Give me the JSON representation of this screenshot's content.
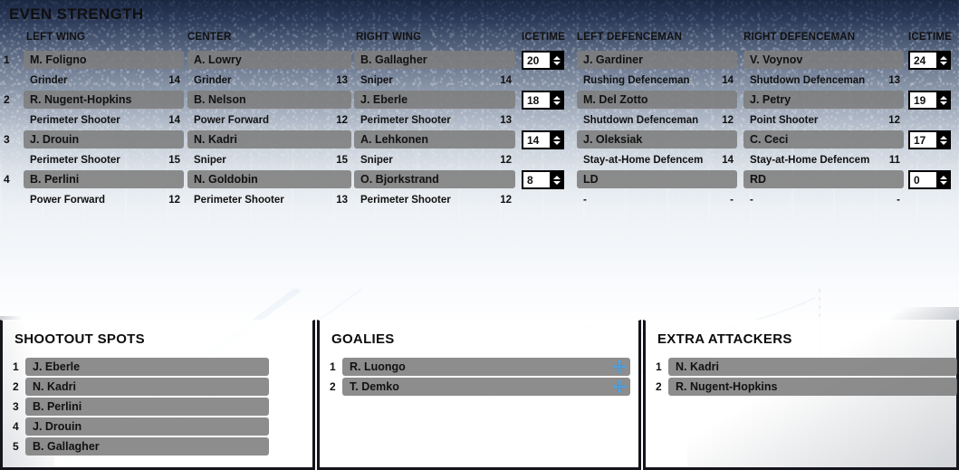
{
  "background": {
    "scene": "hockey-arena-ice-faded",
    "top_color": "#1b2740",
    "bottom_color": "#ffffff"
  },
  "even_strength": {
    "title": "EVEN STRENGTH",
    "headers": {
      "left_wing": "LEFT WING",
      "center": "CENTER",
      "right_wing": "RIGHT WING",
      "icetime_fwd": "ICETIME",
      "left_defenceman": "LEFT DEFENCEMAN",
      "right_defenceman": "RIGHT DEFENCEMAN",
      "icetime_def": "ICETIME"
    },
    "forward_lines": [
      {
        "number": "1",
        "left_wing": {
          "name": "M. Foligno",
          "trait": "Grinder",
          "rating": "14"
        },
        "center": {
          "name": "A. Lowry",
          "trait": "Grinder",
          "rating": "13"
        },
        "right_wing": {
          "name": "B. Gallagher",
          "trait": "Sniper",
          "rating": "14"
        },
        "icetime": "20"
      },
      {
        "number": "2",
        "left_wing": {
          "name": "R. Nugent-Hopkins",
          "trait": "Perimeter Shooter",
          "rating": "14"
        },
        "center": {
          "name": "B. Nelson",
          "trait": "Power Forward",
          "rating": "12"
        },
        "right_wing": {
          "name": "J. Eberle",
          "trait": "Perimeter Shooter",
          "rating": "13"
        },
        "icetime": "18"
      },
      {
        "number": "3",
        "left_wing": {
          "name": "J. Drouin",
          "trait": "Perimeter Shooter",
          "rating": "15"
        },
        "center": {
          "name": "N. Kadri",
          "trait": "Sniper",
          "rating": "15"
        },
        "right_wing": {
          "name": "A. Lehkonen",
          "trait": "Sniper",
          "rating": "12"
        },
        "icetime": "14"
      },
      {
        "number": "4",
        "left_wing": {
          "name": "B. Perlini",
          "trait": "Power Forward",
          "rating": "12"
        },
        "center": {
          "name": "N. Goldobin",
          "trait": "Perimeter Shooter",
          "rating": "13"
        },
        "right_wing": {
          "name": "O. Bjorkstrand",
          "trait": "Perimeter Shooter",
          "rating": "12"
        },
        "icetime": "8"
      }
    ],
    "defence_pairs": [
      {
        "left_defenceman": {
          "name": "J. Gardiner",
          "trait": "Rushing Defenceman",
          "rating": "14"
        },
        "right_defenceman": {
          "name": "V. Voynov",
          "trait": "Shutdown Defenceman",
          "rating": "13"
        },
        "icetime": "24"
      },
      {
        "left_defenceman": {
          "name": "M. Del Zotto",
          "trait": "Shutdown Defenceman",
          "rating": "12"
        },
        "right_defenceman": {
          "name": "J. Petry",
          "trait": "Point Shooter",
          "rating": "12"
        },
        "icetime": "19"
      },
      {
        "left_defenceman": {
          "name": "J. Oleksiak",
          "trait": "Stay-at-Home Defencem",
          "rating": "14"
        },
        "right_defenceman": {
          "name": "C. Ceci",
          "trait": "Stay-at-Home Defencem",
          "rating": "11"
        },
        "icetime": "17"
      },
      {
        "left_defenceman": {
          "name": "LD",
          "trait": "-",
          "rating": "-"
        },
        "right_defenceman": {
          "name": "RD",
          "trait": "-",
          "rating": "-"
        },
        "icetime": "0"
      }
    ]
  },
  "shootout_spots": {
    "title": "SHOOTOUT SPOTS",
    "rows": [
      {
        "number": "1",
        "name": "J. Eberle"
      },
      {
        "number": "2",
        "name": "N. Kadri"
      },
      {
        "number": "3",
        "name": "B. Perlini"
      },
      {
        "number": "4",
        "name": "J. Drouin"
      },
      {
        "number": "5",
        "name": "B. Gallagher"
      }
    ]
  },
  "goalies": {
    "title": "GOALIES",
    "rows": [
      {
        "number": "1",
        "name": "R. Luongo",
        "icon": "move-icon"
      },
      {
        "number": "2",
        "name": "T. Demko",
        "icon": "move-icon"
      }
    ]
  },
  "extra_attackers": {
    "title": "EXTRA ATTACKERS",
    "rows": [
      {
        "number": "1",
        "name": "N. Kadri"
      },
      {
        "number": "2",
        "name": "R. Nugent-Hopkins"
      }
    ]
  }
}
